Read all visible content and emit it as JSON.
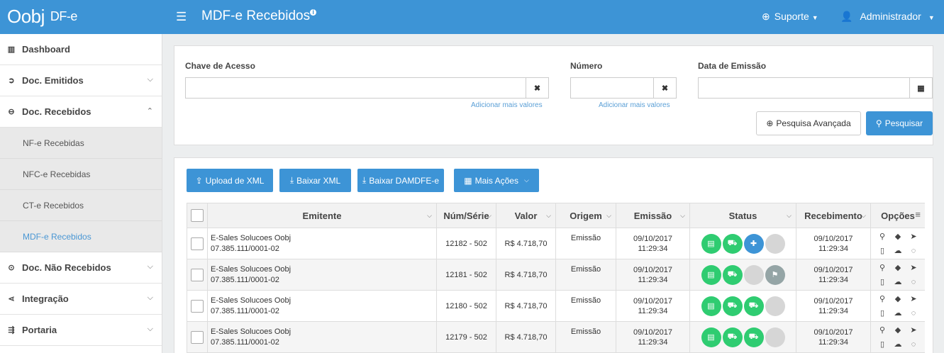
{
  "app": {
    "logo": "Oobj",
    "logo_sub": "DF-e",
    "page_title": "MDF-e Recebidos",
    "info_badge": "i"
  },
  "topnav": {
    "support": "Suporte",
    "user": "Administrador"
  },
  "sidebar": {
    "items": [
      {
        "label": "Dashboard",
        "icon": "bar-chart-icon"
      },
      {
        "label": "Doc. Emitidos",
        "icon": "circle-arrow-right-icon"
      },
      {
        "label": "Doc. Recebidos",
        "icon": "circle-arrow-left-icon"
      },
      {
        "label": "Doc. Não Recebidos",
        "icon": "circle-dot-icon"
      },
      {
        "label": "Integração",
        "icon": "share-icon"
      },
      {
        "label": "Portaria",
        "icon": "signpost-icon"
      }
    ],
    "subitems": [
      "NF-e Recebidas",
      "NFC-e Recebidas",
      "CT-e Recebidos",
      "MDF-e Recebidos"
    ]
  },
  "filters": {
    "chave_label": "Chave de Acesso",
    "numero_label": "Número",
    "data_label": "Data de Emissão",
    "add_more": "Adicionar mais valores",
    "btn_advanced": "Pesquisa Avançada",
    "btn_search": "Pesquisar"
  },
  "actions": {
    "upload": "Upload de XML",
    "download_xml": "Baixar XML",
    "download_damdfe": "Baixar DAMDFE-e",
    "more": "Mais Ações"
  },
  "table": {
    "headers": {
      "emitente": "Emitente",
      "num_serie": "Núm/Série",
      "valor": "Valor",
      "origem": "Origem",
      "emissao": "Emissão",
      "status": "Status",
      "recebimento": "Recebimento",
      "opcoes": "Opções"
    },
    "rows": [
      {
        "emitente": "E-Sales Solucoes Oobj",
        "cnpj": "07.385.111/0001-02",
        "num_serie": "12182 - 502",
        "valor": "R$ 4.718,70",
        "origem": "Emissão",
        "emissao_date": "09/10/2017",
        "emissao_time": "11:29:34",
        "receb_date": "09/10/2017",
        "receb_time": "11:29:34"
      },
      {
        "emitente": "E-Sales Solucoes Oobj",
        "cnpj": "07.385.111/0001-02",
        "num_serie": "12181 - 502",
        "valor": "R$ 4.718,70",
        "origem": "Emissão",
        "emissao_date": "09/10/2017",
        "emissao_time": "11:29:34",
        "receb_date": "09/10/2017",
        "receb_time": "11:29:34"
      },
      {
        "emitente": "E-Sales Solucoes Oobj",
        "cnpj": "07.385.111/0001-02",
        "num_serie": "12180 - 502",
        "valor": "R$ 4.718,70",
        "origem": "Emissão",
        "emissao_date": "09/10/2017",
        "emissao_time": "11:29:34",
        "receb_date": "09/10/2017",
        "receb_time": "11:29:34"
      },
      {
        "emitente": "E-Sales Solucoes Oobj",
        "cnpj": "07.385.111/0001-02",
        "num_serie": "12179 - 502",
        "valor": "R$ 4.718,70",
        "origem": "Emissão",
        "emissao_date": "09/10/2017",
        "emissao_time": "11:29:34",
        "receb_date": "09/10/2017",
        "receb_time": "11:29:34"
      }
    ]
  },
  "colors": {
    "primary": "#3d94d6",
    "green": "#2fcc71",
    "gray": "#d6d6d6",
    "dark_gray": "#95a5a6",
    "active_link": "#4a97d4"
  }
}
